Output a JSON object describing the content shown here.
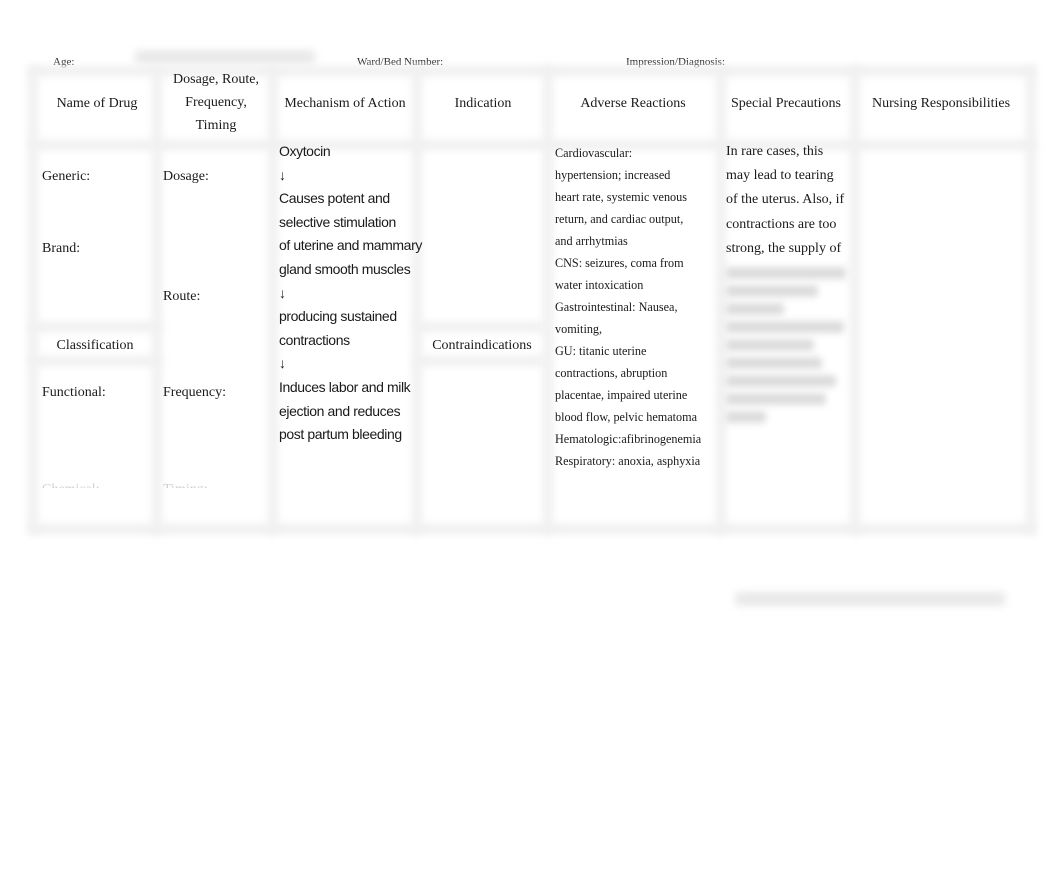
{
  "header_fields": {
    "age_label": "Age:",
    "ward_label": "Ward/Bed Number:",
    "diagnosis_label": "Impression/Diagnosis:"
  },
  "table": {
    "columns": [
      "Name of Drug",
      "Dosage, Route, Frequency, Timing",
      "Mechanism of Action",
      "Indication",
      "Adverse Reactions",
      "Special Precautions",
      "Nursing Responsibilities"
    ],
    "dosage_header_lines": [
      "Dosage, Route,",
      "Frequency,",
      "Timing"
    ],
    "name_of_drug": {
      "generic_label": "Generic:",
      "brand_label": "Brand:",
      "classification_header": "Classification",
      "functional_label": "Functional:",
      "chemical_label": "Chemical:"
    },
    "dosage": {
      "dosage_label": "Dosage:",
      "route_label": "Route:",
      "frequency_label": "Frequency:",
      "timing_label": "Timing:"
    },
    "mechanism_lines": [
      "Oxytocin",
      "↓",
      "Causes potent and",
      "selective stimulation",
      "of uterine and mammary",
      "gland smooth muscles",
      "↓",
      " producing sustained",
      "contractions",
      "↓",
      "Induces labor and milk",
      "ejection and reduces",
      "post partum bleeding"
    ],
    "indication": {
      "contraindications_header": "Contraindications"
    },
    "adverse_reactions_lines": [
      "Cardiovascular:",
      "hypertension; increased",
      "heart rate, systemic venous",
      "return, and cardiac output,",
      "and arrhytmias",
      "CNS: seizures, coma from",
      "water intoxication",
      "Gastrointestinal: Nausea,",
      "vomiting,",
      "GU: titanic uterine",
      "contractions, abruption",
      "placentae, impaired uterine",
      "blood flow, pelvic hematoma",
      "Hematologic:afibrinogenemia",
      "Respiratory: anoxia, asphyxia"
    ],
    "special_precautions_lines": [
      "In rare cases, this",
      "may lead to tearing",
      "of the uterus. Also, if",
      "contractions are too",
      "strong, the supply of"
    ],
    "special_precautions_blurred_line_count": 9
  }
}
